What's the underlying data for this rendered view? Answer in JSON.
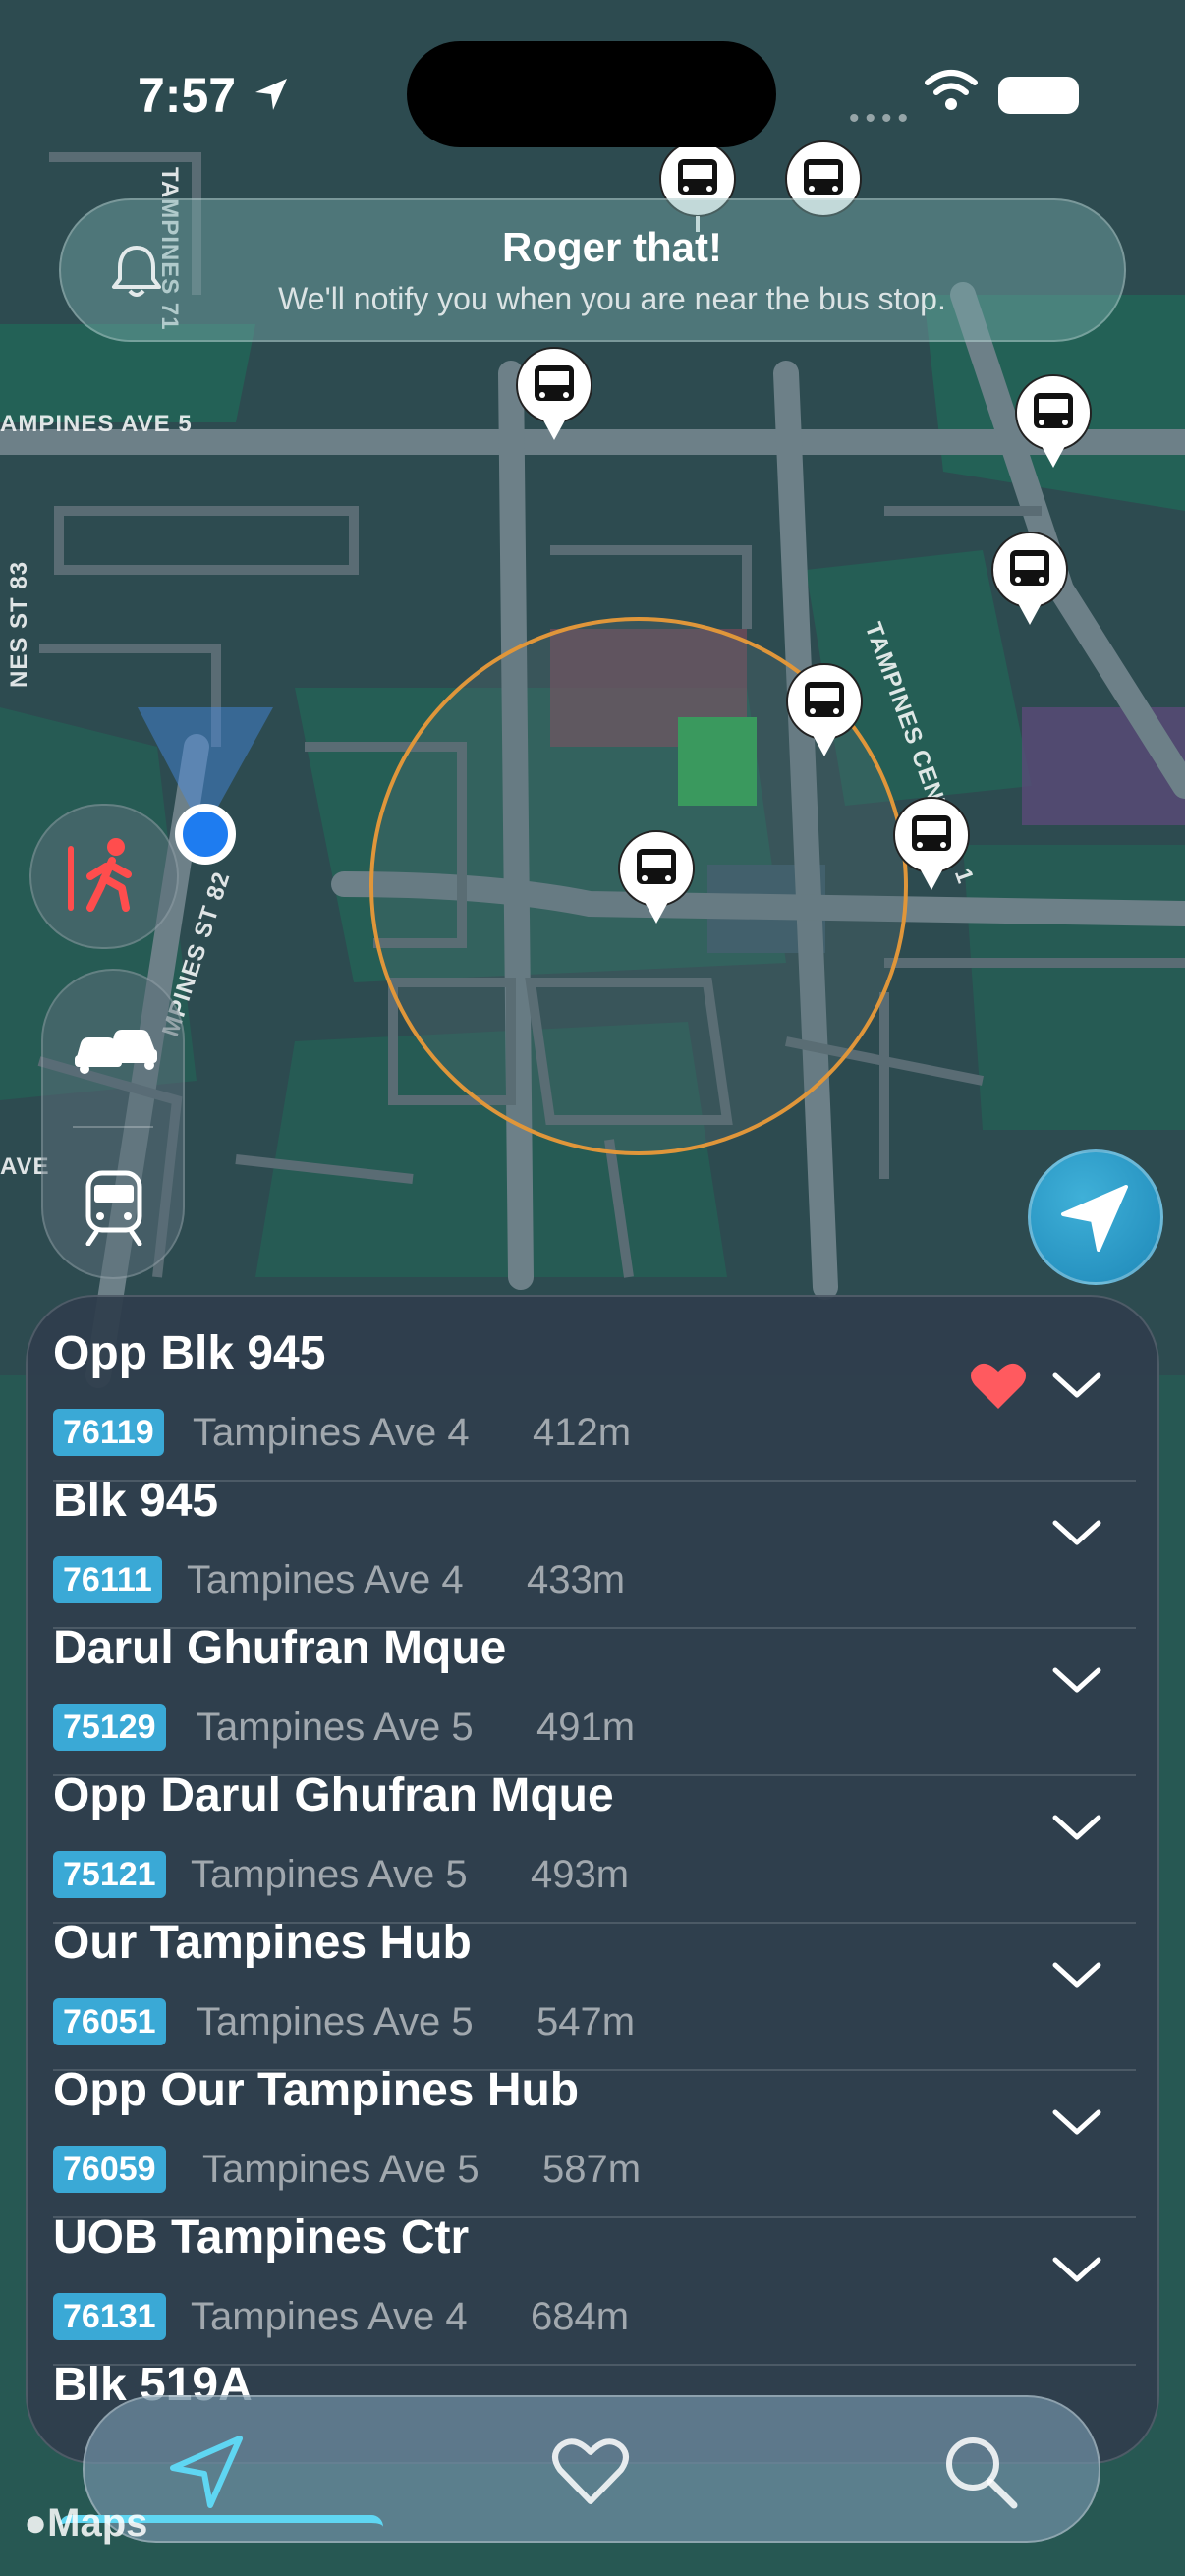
{
  "status_bar": {
    "time": "7:57",
    "signal_dots": "••••"
  },
  "banner": {
    "title": "Roger that!",
    "subtitle": "We'll notify you when you are near the bus stop.",
    "icon": "bell-icon"
  },
  "map": {
    "street_labels": [
      "AMPINES AVE 5",
      "TAMPINES CENTRAL 1",
      "MPINES ST 82",
      "NES ST 83",
      "TAMPINES 71",
      "AVE"
    ],
    "radius_color": "#e0963a",
    "user_location_color": "#1e7cf0"
  },
  "controls": {
    "walk_icon": "walk-icon",
    "car_icon": "car-icon",
    "train_icon": "train-icon",
    "locate_icon": "location-arrow-icon"
  },
  "stops": [
    {
      "name": "Opp Blk 945",
      "code": "76119",
      "road": "Tampines Ave 4",
      "distance": "412m",
      "favorite": true
    },
    {
      "name": "Blk 945",
      "code": "76111",
      "road": "Tampines Ave 4",
      "distance": "433m",
      "favorite": false
    },
    {
      "name": "Darul Ghufran Mque",
      "code": "75129",
      "road": "Tampines Ave 5",
      "distance": "491m",
      "favorite": false
    },
    {
      "name": "Opp Darul Ghufran Mque",
      "code": "75121",
      "road": "Tampines Ave 5",
      "distance": "493m",
      "favorite": false
    },
    {
      "name": "Our Tampines Hub",
      "code": "76051",
      "road": "Tampines Ave 5",
      "distance": "547m",
      "favorite": false
    },
    {
      "name": "Opp Our Tampines Hub",
      "code": "76059",
      "road": "Tampines Ave 5",
      "distance": "587m",
      "favorite": false
    },
    {
      "name": "UOB Tampines Ctr",
      "code": "76131",
      "road": "Tampines Ave 4",
      "distance": "684m",
      "favorite": false
    },
    {
      "name": "Blk 519A",
      "code": "",
      "road": "",
      "distance": "",
      "favorite": false
    }
  ],
  "tabbar": {
    "tabs": [
      {
        "icon": "nearby-arrow-icon",
        "active": true
      },
      {
        "icon": "heart-icon",
        "active": false
      },
      {
        "icon": "search-icon",
        "active": false
      }
    ],
    "accent": "#5fd6f2"
  },
  "attribution": "Maps"
}
